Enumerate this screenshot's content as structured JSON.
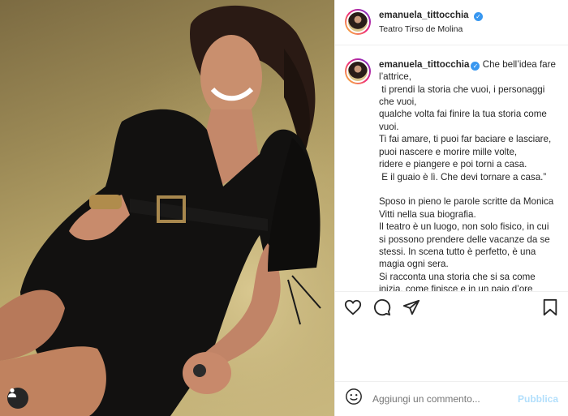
{
  "post": {
    "username": "emanuela_tittocchia",
    "location": "Teatro Tirso de Molina",
    "caption": "Che bell’idea fare l’attrice,\n ti prendi la storia che vuoi, i personaggi che vuoi,\nqualche volta fai finire la tua storia come vuoi.\nTi fai amare, ti puoi far baciare e lasciare, puoi nascere e morire mille volte,\nridere e piangere e poi torni a casa.\n E il guaio è lì. Che devi tornare a casa.”\n\nSposo in pieno le parole scritte da Monica Vitti nella sua biografia.\nIl teatro è un luogo, non solo fisico, in cui si possono prendere delle vacanze da se stessi. In scena tutto è perfetto, è una magia ogni sera.\nSi racconta una storia che si sa come inizia, come finisce e in un paio d’ore"
  },
  "comment_box": {
    "placeholder": "Aggiungi un commento...",
    "publish_label": "Pubblica"
  },
  "icons": {
    "user_tag": "user-icon",
    "like": "heart-icon",
    "comment": "comment-icon",
    "share": "share-icon",
    "save": "bookmark-icon",
    "emoji": "emoji-icon"
  },
  "colors": {
    "verified": "#3897f0",
    "publish_disabled": "#b2dffc",
    "text": "#262626"
  }
}
